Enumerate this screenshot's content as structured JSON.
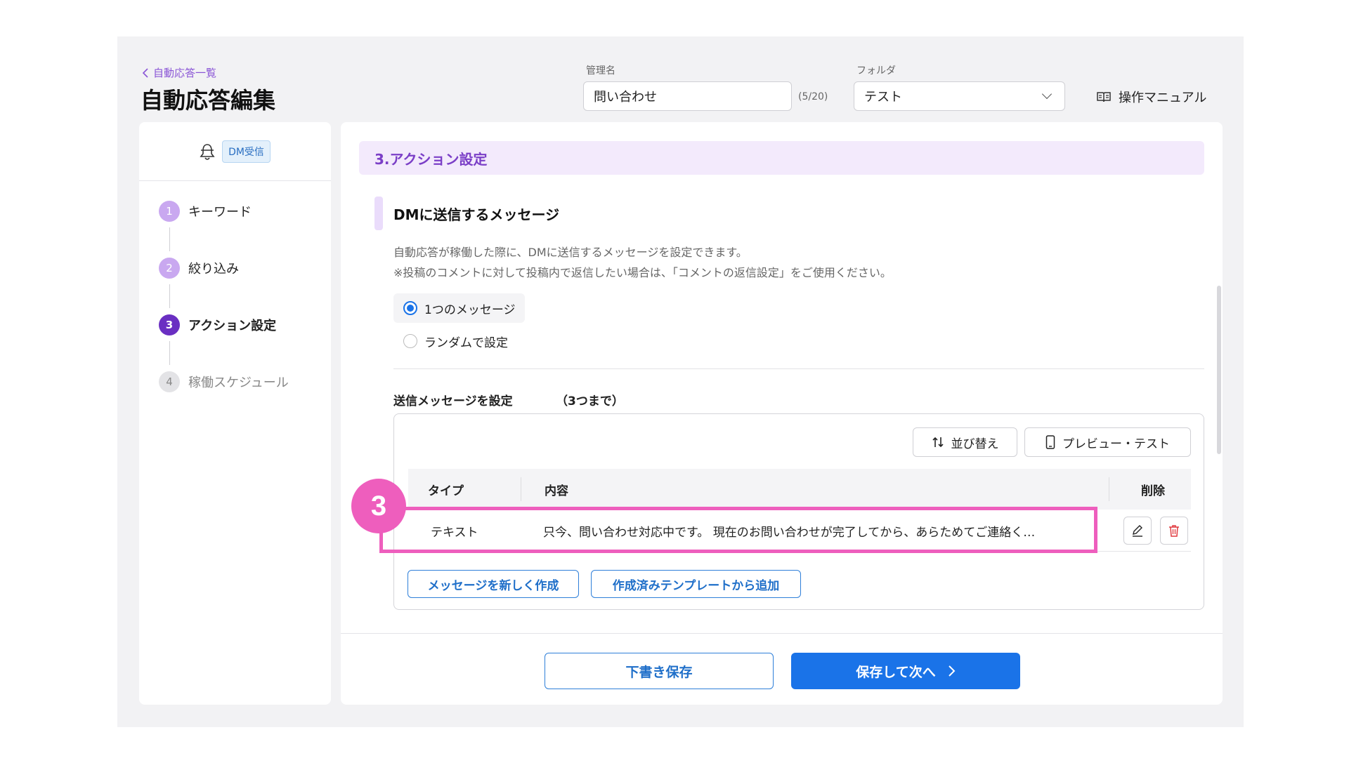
{
  "header": {
    "back_link": "自動応答一覧",
    "title": "自動応答編集",
    "name_label": "管理名",
    "name_value": "問い合わせ",
    "name_counter": "(5/20)",
    "folder_label": "フォルダ",
    "folder_value": "テスト",
    "manual_label": "操作マニュアル"
  },
  "sidebar": {
    "trigger_badge": "DM受信",
    "steps": [
      {
        "num": "1",
        "label": "キーワード",
        "state": "done"
      },
      {
        "num": "2",
        "label": "絞り込み",
        "state": "done"
      },
      {
        "num": "3",
        "label": "アクション設定",
        "state": "active"
      },
      {
        "num": "4",
        "label": "稼働スケジュール",
        "state": "pending"
      }
    ]
  },
  "main": {
    "section_title": "3.アクション設定",
    "subsection_title": "DMに送信するメッセージ",
    "description_1": "自動応答が稼働した際に、DMに送信するメッセージを設定できます。",
    "description_2": "※投稿のコメントに対して投稿内で返信したい場合は、「コメントの返信設定」をご使用ください。",
    "radio_single": "1つのメッセージ",
    "radio_random": "ランダムで設定",
    "selected_mode": "1つのメッセージ",
    "messages_label": "送信メッセージを設定",
    "messages_limit": "（3つまで）",
    "sort_button": "並び替え",
    "preview_button": "プレビュー・テスト",
    "table": {
      "col_type": "タイプ",
      "col_content": "内容",
      "col_delete": "削除",
      "rows": [
        {
          "type": "テキスト",
          "content": "只今、問い合わせ対応中です。 現在のお問い合わせが完了してから、あらためてご連絡く…"
        }
      ]
    },
    "new_message_button": "メッセージを新しく作成",
    "template_button": "作成済みテンプレートから追加",
    "draft_button": "下書き保存",
    "next_button": "保存して次へ"
  },
  "annotation": {
    "marker": "3"
  },
  "colors": {
    "accent_purple": "#7b3fc7",
    "primary_blue": "#1a73e8",
    "highlight_pink": "#ee5ebd",
    "delete_red": "#e0393e"
  }
}
